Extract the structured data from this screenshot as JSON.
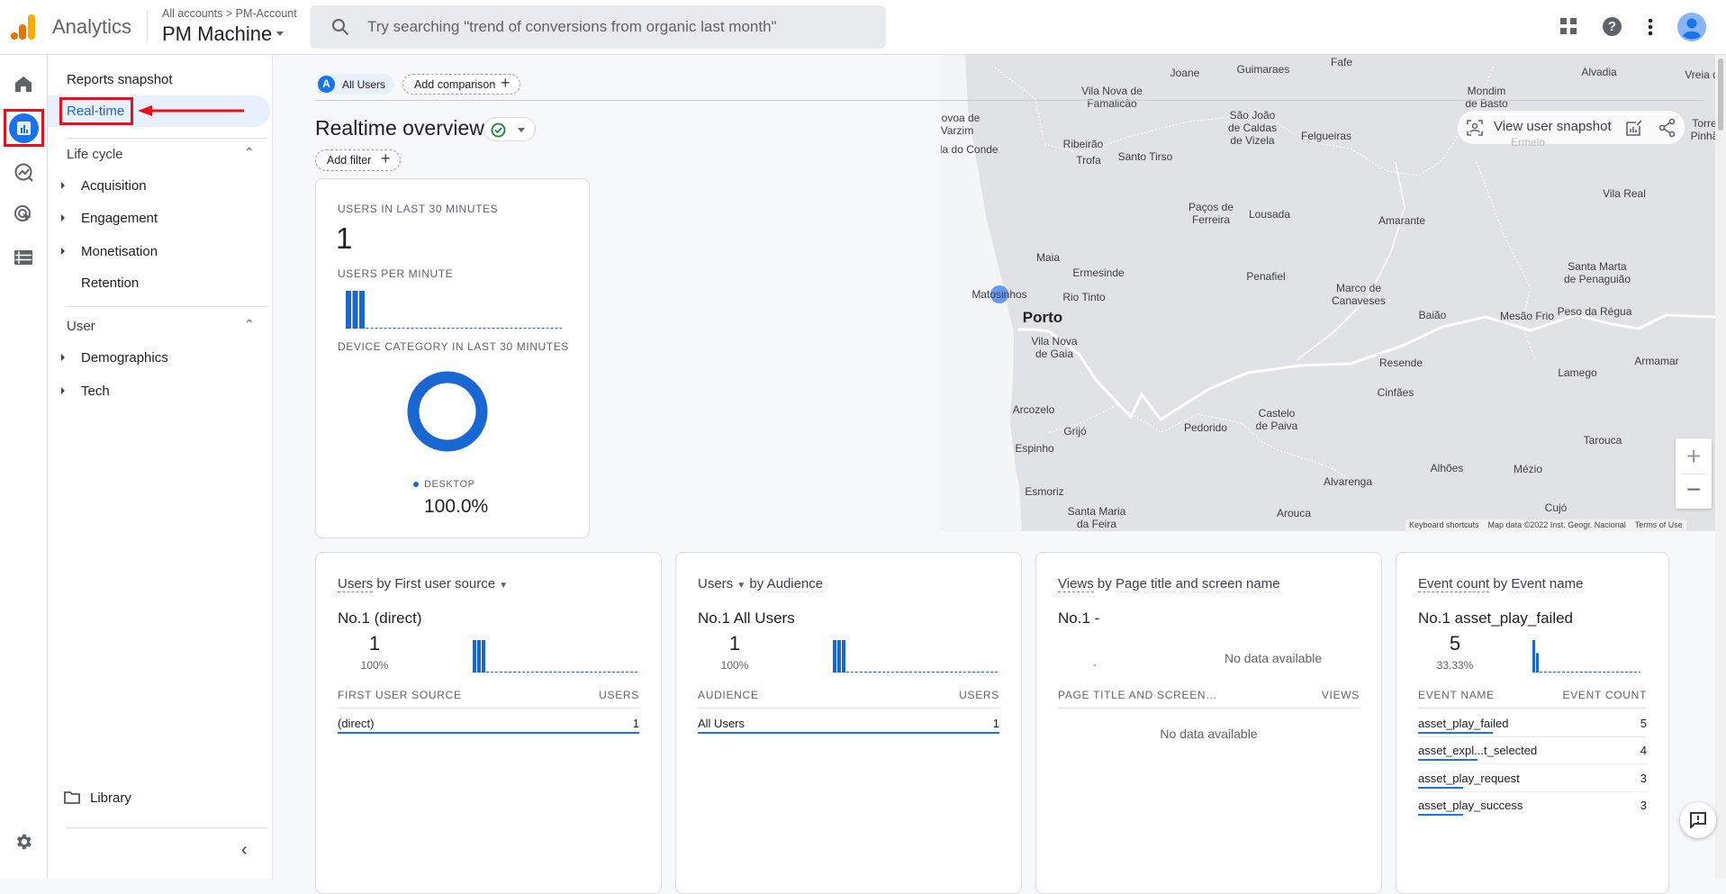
{
  "header": {
    "app_name": "Analytics",
    "breadcrumb": "All accounts > PM-Account",
    "property": "PM Machine",
    "search_placeholder": "Try searching \"trend of conversions from organic last month\""
  },
  "nav": {
    "reports_snapshot": "Reports snapshot",
    "realtime": "Real-time",
    "lifecycle": {
      "label": "Life cycle",
      "items": [
        "Acquisition",
        "Engagement",
        "Monetisation",
        "Retention"
      ]
    },
    "user": {
      "label": "User",
      "items": [
        "Demographics",
        "Tech"
      ]
    },
    "library": "Library"
  },
  "toolbar": {
    "segment_letter": "A",
    "segment": "All Users",
    "add_comparison": "Add comparison",
    "title": "Realtime overview",
    "add_filter": "Add filter"
  },
  "overview_card": {
    "users_label": "Users in last 30 minutes",
    "users_value": "1",
    "per_minute_label": "Users per minute",
    "device_label": "Device category in last 30 minutes",
    "device_name": "DESKTOP",
    "device_pct": "100.0%"
  },
  "map": {
    "view_snapshot": "View user snapshot",
    "labels": [
      "Fafe",
      "Joane",
      "Guimaraes",
      "Alvadia",
      "Vreia d",
      "Vila Nova de\nFamalicão",
      "Mondim\nde Basto",
      "Povoa de\nVarzim",
      "São João\nde Caldas\nde Vizela",
      "Felgueiras",
      "Ribeirão",
      "Vila do Conde",
      "Trofa",
      "Santo Tirso",
      "Torre\nPinhã",
      "Vila Real",
      "Paços de\nFerreira",
      "Lousada",
      "Amarante",
      "Maia",
      "Ermesinde",
      "Penafiel",
      "Santa Marta\nde Penaguião",
      "Marco de\nCanaveses",
      "Matosinhos",
      "Rio Tinto",
      "Porto",
      "Baião",
      "Mesão Frio",
      "Peso da Régua",
      "Vila Nova\nde Gaia",
      "Resende",
      "Lamego",
      "Armamar",
      "Cinfães",
      "Arcozelo",
      "Castelo\nde Paiva",
      "Pedorido",
      "Grijó",
      "Tarouca",
      "Espinho",
      "Alhões",
      "Mézio",
      "Alvarenga",
      "Esmoriz",
      "Cujó",
      "Santa Maria\nda Feira",
      "Arouca",
      "Ermelo"
    ],
    "attribution": [
      "Keyboard shortcuts",
      "Map data ©2022 Inst. Geogr. Nacional",
      "Terms of Use"
    ]
  },
  "cards": [
    {
      "title_metric": "Users",
      "title_rest": " by First user source",
      "no1": "No.1  (direct)",
      "value": "1",
      "pct": "100%",
      "col1": "FIRST USER SOURCE",
      "col2": "USERS",
      "rows": [
        {
          "name": "(direct)",
          "value": "1"
        }
      ]
    },
    {
      "title_metric": "Users",
      "title_rest": "by Audience",
      "no1": "No.1  All Users",
      "value": "1",
      "pct": "100%",
      "col1": "AUDIENCE",
      "col2": "USERS",
      "rows": [
        {
          "name": "All Users",
          "value": "1"
        }
      ]
    },
    {
      "title_metric": "Views",
      "title_rest": "Page title and screen name",
      "title_by": " by ",
      "no1": "No.1  -",
      "value": "-",
      "nodata": "No data available",
      "col1": "PAGE TITLE AND SCREEN…",
      "col2": "VIEWS",
      "table_nodata": "No data available"
    },
    {
      "title_metric": "Event count",
      "title_by": " by ",
      "title_rest": "Event name",
      "no1": "No.1  asset_play_failed",
      "value": "5",
      "pct": "33.33%",
      "col1": "EVENT NAME",
      "col2": "EVENT COUNT",
      "rows": [
        {
          "name": "asset_play_failed",
          "value": "5"
        },
        {
          "name": "asset_expl...t_selected",
          "value": "4"
        },
        {
          "name": "asset_play_request",
          "value": "3"
        },
        {
          "name": "asset_play_success",
          "value": "3"
        }
      ]
    }
  ],
  "colors": {
    "accent": "#1a73e8",
    "bar": "#1967d2",
    "highlight_box": "#e8101a",
    "nav_selected_bg": "#e8f0fe"
  },
  "chart_data": [
    {
      "type": "bar",
      "name_ref": "users per minute",
      "values": [
        1,
        1,
        1,
        0,
        0,
        0,
        0,
        0,
        0,
        0,
        0,
        0,
        0,
        0,
        0,
        0,
        0,
        0,
        0,
        0,
        0,
        0,
        0,
        0,
        0,
        0,
        0,
        0,
        0,
        0
      ]
    },
    {
      "type": "pie",
      "categories": [
        "DESKTOP"
      ],
      "values": [
        100.0
      ]
    },
    {
      "type": "bar",
      "name_ref": "first user source minutes",
      "values": [
        1,
        1,
        1,
        0,
        0,
        0,
        0,
        0,
        0,
        0,
        0,
        0,
        0,
        0,
        0,
        0,
        0,
        0,
        0,
        0,
        0,
        0,
        0,
        0,
        0,
        0,
        0,
        0,
        0,
        0
      ]
    },
    {
      "type": "bar",
      "name_ref": "audience minutes",
      "values": [
        1,
        1,
        1,
        0,
        0,
        0,
        0,
        0,
        0,
        0,
        0,
        0,
        0,
        0,
        0,
        0,
        0,
        0,
        0,
        0,
        0,
        0,
        0,
        0,
        0,
        0,
        0,
        0,
        0,
        0
      ]
    },
    {
      "type": "bar",
      "name_ref": "event count minutes",
      "values": [
        5,
        3,
        0,
        0,
        0,
        0,
        0,
        0,
        0,
        0,
        0,
        0,
        0,
        0,
        0,
        0,
        0,
        0,
        0,
        0,
        0,
        0,
        0,
        0,
        0,
        0,
        0,
        0,
        0,
        0
      ]
    }
  ]
}
